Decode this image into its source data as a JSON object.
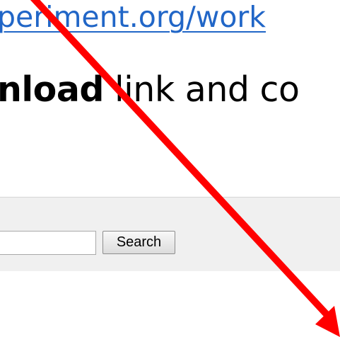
{
  "page": {
    "url_fragment": "periment.org/work",
    "instruction": {
      "bold_part": "nload",
      "rest": " link and co"
    }
  },
  "search": {
    "input_value": "",
    "button_label": "Search"
  },
  "annotation": {
    "arrow_color": "#ff0000"
  }
}
